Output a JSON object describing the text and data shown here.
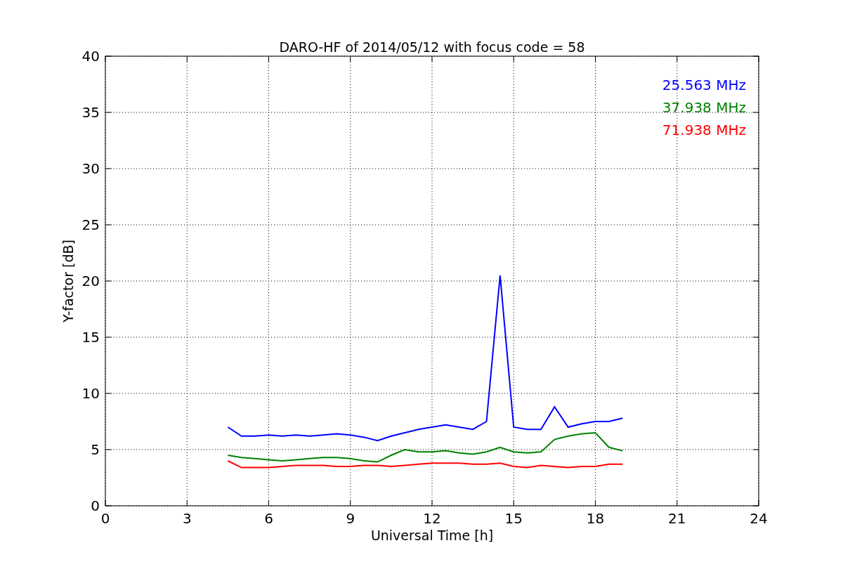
{
  "figure": {
    "chart_data": {
      "type": "line",
      "title": "DARO-HF of 2014/05/12 with focus code = 58",
      "xlabel": "Universal Time [h]",
      "ylabel": "Y-factor [dB]",
      "x": [
        4.5,
        5.0,
        5.5,
        6.0,
        6.5,
        7.0,
        7.5,
        8.0,
        8.5,
        9.0,
        9.5,
        10.0,
        10.5,
        11.0,
        11.5,
        12.0,
        12.5,
        13.0,
        13.5,
        14.0,
        14.5,
        15.0,
        15.5,
        16.0,
        16.5,
        17.0,
        17.5,
        18.0,
        18.5,
        19.0
      ],
      "series": [
        {
          "name": "25.563 MHz",
          "color": "#0000ff",
          "values": [
            7.0,
            6.2,
            6.2,
            6.3,
            6.2,
            6.3,
            6.2,
            6.3,
            6.4,
            6.3,
            6.1,
            5.8,
            6.2,
            6.5,
            6.8,
            7.0,
            7.2,
            7.0,
            6.8,
            7.5,
            20.5,
            7.0,
            6.8,
            6.8,
            8.8,
            7.0,
            7.3,
            7.5,
            7.5,
            7.8
          ]
        },
        {
          "name": "37.938 MHz",
          "color": "#008000",
          "values": [
            4.5,
            4.3,
            4.2,
            4.1,
            4.0,
            4.1,
            4.2,
            4.3,
            4.3,
            4.2,
            4.0,
            3.9,
            4.5,
            5.0,
            4.8,
            4.8,
            4.9,
            4.7,
            4.6,
            4.8,
            5.2,
            4.8,
            4.7,
            4.8,
            5.9,
            6.2,
            6.4,
            6.5,
            5.2,
            4.9
          ]
        },
        {
          "name": "71.938 MHz",
          "color": "#ff0000",
          "values": [
            4.0,
            3.4,
            3.4,
            3.4,
            3.5,
            3.6,
            3.6,
            3.6,
            3.5,
            3.5,
            3.6,
            3.6,
            3.5,
            3.6,
            3.7,
            3.8,
            3.8,
            3.8,
            3.7,
            3.7,
            3.8,
            3.5,
            3.4,
            3.6,
            3.5,
            3.4,
            3.5,
            3.5,
            3.7,
            3.7
          ]
        }
      ],
      "xlim": [
        0,
        24
      ],
      "ylim": [
        0,
        40
      ],
      "xticks": [
        0,
        3,
        6,
        9,
        12,
        15,
        18,
        21,
        24
      ],
      "yticks": [
        0,
        5,
        10,
        15,
        20,
        25,
        30,
        35,
        40
      ],
      "grid": true
    }
  }
}
